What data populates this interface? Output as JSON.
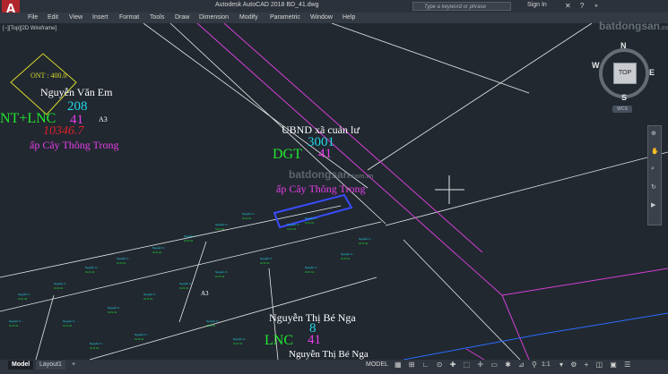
{
  "app": {
    "logo_letter": "A",
    "title": "Autodesk AutoCAD 2018    BD_41.dwg",
    "search_placeholder": "Type a keyword or phrase",
    "sign_in": "Sign In"
  },
  "menu": [
    "File",
    "Edit",
    "View",
    "Insert",
    "Format",
    "Tools",
    "Draw",
    "Dimension",
    "Modify",
    "Parametric",
    "Window",
    "Help"
  ],
  "viewport_label": "[−][Top][2D Wireframe]",
  "viewcube": {
    "top": "TOP",
    "n": "N",
    "s": "S",
    "e": "E",
    "w": "W",
    "wcs": "WCS"
  },
  "watermark": {
    "site": "batdongsan",
    "domain": ".com.vn"
  },
  "drawing": {
    "parcel_left": {
      "zone_code": "ONT : 400.0",
      "owner": "Nguyễn Văn Em",
      "parcel_no": "208",
      "land_use": "NT+LNC",
      "sheet_no": "41",
      "sheet_code": "A3",
      "area": "10346.7",
      "address": "ấp Cây Thông Trong"
    },
    "parcel_center": {
      "owner": "UBND xã cuản lư",
      "parcel_no": "3001",
      "land_use": "DGT",
      "sheet_no": "41",
      "address": "ấp Cây Thông Trong"
    },
    "parcel_bottom": {
      "owner": "Nguyễn Thị Bé Nga",
      "parcel_no": "8",
      "land_use": "LNC",
      "sheet_no": "41",
      "owner_repeat": "Nguyễn Thị Bé Nga"
    },
    "sheet_label_small": "A3"
  },
  "statusbar": {
    "tabs": [
      "Model",
      "Layout1"
    ],
    "add_tab": "+",
    "mode": "MODEL",
    "scale": "1:1"
  },
  "colors": {
    "background": "#212830",
    "cyan": "#22d7e6",
    "green": "#22e62f",
    "magenta": "#e83ee8",
    "red": "#e0202a",
    "white": "#ffffff",
    "yellow": "#d7d72a",
    "blue": "#2b4bff"
  }
}
